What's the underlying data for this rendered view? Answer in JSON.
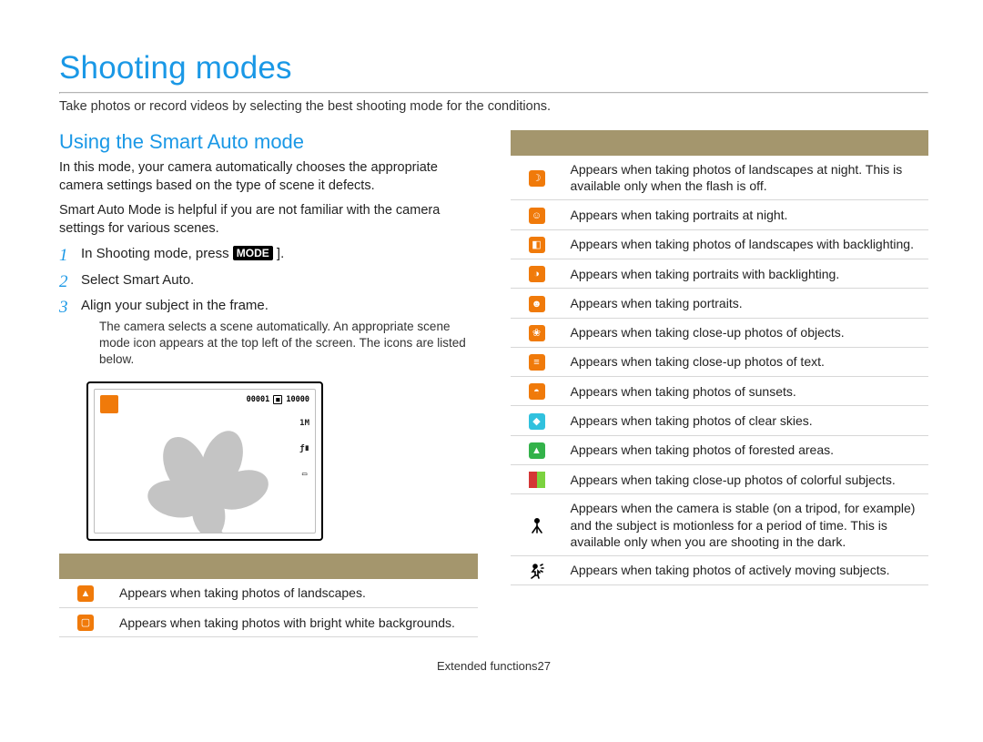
{
  "title": "Shooting modes",
  "subtitle": "Take photos or record videos by selecting the best shooting mode for the conditions.",
  "section": {
    "heading": "Using the Smart Auto mode",
    "para1": "In this mode, your camera automatically chooses the appropriate camera settings based on the type of scene it defects.",
    "para2": "Smart Auto Mode is helpful if you are not familiar with the camera settings for various scenes."
  },
  "steps": [
    {
      "pre": "In Shooting mode, press ",
      "chip": "MODE",
      "post": " ]."
    },
    {
      "pre": "Select Smart Auto."
    },
    {
      "pre": "Align your subject in the frame.",
      "sub": "The camera selects a scene automatically. An appropriate scene mode icon appears at the top left of the screen. The icons are listed below."
    }
  ],
  "screen": {
    "counter": "00001",
    "card": "■",
    "count2": "10000",
    "size": "1M",
    "flash": "ƒ∎",
    "batt": "▭"
  },
  "table_header": {
    "icon": "",
    "desc": ""
  },
  "left_rows": [
    {
      "kind": "orange",
      "glyph": "▲",
      "name": "landscape-icon",
      "text": "Appears when taking photos of landscapes."
    },
    {
      "kind": "orange",
      "glyph": "▢",
      "name": "white-bg-icon",
      "text": "Appears when taking photos with bright white backgrounds."
    }
  ],
  "right_rows": [
    {
      "kind": "orange",
      "glyph": "☽",
      "name": "night-landscape-icon",
      "text": "Appears when taking photos of landscapes at night. This is available only when the flash is off."
    },
    {
      "kind": "orange",
      "glyph": "☺",
      "name": "night-portrait-icon",
      "text": "Appears when taking portraits at night."
    },
    {
      "kind": "orange",
      "glyph": "◧",
      "name": "backlit-landscape-icon",
      "text": "Appears when taking photos of landscapes with backlighting."
    },
    {
      "kind": "orange",
      "glyph": "◑",
      "name": "backlit-portrait-icon",
      "text": "Appears when taking portraits with backlighting."
    },
    {
      "kind": "orange",
      "glyph": "☻",
      "name": "portrait-icon",
      "text": "Appears when taking portraits."
    },
    {
      "kind": "orange",
      "glyph": "❀",
      "name": "macro-icon",
      "text": "Appears when taking close-up photos of objects."
    },
    {
      "kind": "orange",
      "glyph": "≡",
      "name": "macro-text-icon",
      "text": "Appears when taking close-up photos of text."
    },
    {
      "kind": "orange",
      "glyph": "◓",
      "name": "sunset-icon",
      "text": "Appears when taking photos of sunsets."
    },
    {
      "kind": "cyan",
      "glyph": "◆",
      "name": "clear-sky-icon",
      "text": "Appears when taking photos of clear skies."
    },
    {
      "kind": "green",
      "glyph": "▲",
      "name": "forest-icon",
      "text": "Appears when taking photos of forested areas."
    },
    {
      "kind": "half",
      "glyph": "",
      "name": "macro-color-icon",
      "text": "Appears when taking close-up photos of colorful subjects."
    },
    {
      "kind": "outline",
      "glyph": "tripod",
      "name": "tripod-icon",
      "text": "Appears when the camera is stable (on a tripod, for example) and the subject is motionless for a period of time. This is available only when you are shooting in the dark."
    },
    {
      "kind": "outline",
      "glyph": "action",
      "name": "action-icon",
      "text": "Appears when taking photos of actively moving subjects."
    }
  ],
  "footer": {
    "label": "Extended functions",
    "page": "27"
  }
}
